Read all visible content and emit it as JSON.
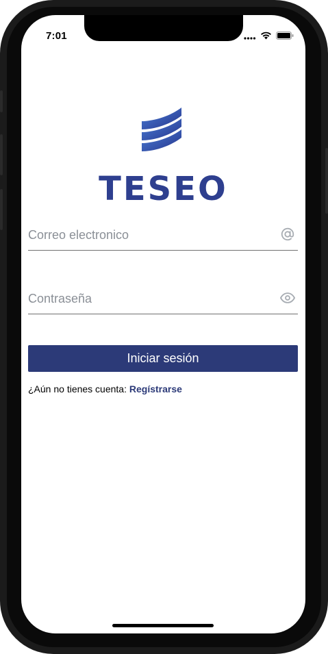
{
  "status_bar": {
    "time": "7:01"
  },
  "brand": {
    "name": "TESEO"
  },
  "login_form": {
    "email_placeholder": "Correo electronico",
    "password_placeholder": "Contraseña",
    "email_icon": "at-icon",
    "password_icon": "eye-icon",
    "submit_label": "Iniciar sesión",
    "register_prompt": "¿Aún no tienes cuenta: ",
    "register_link": "Regístrarse"
  },
  "colors": {
    "primary": "#2c3a78",
    "brand_blue": "#2e3f8f",
    "placeholder": "#8a8f96"
  }
}
